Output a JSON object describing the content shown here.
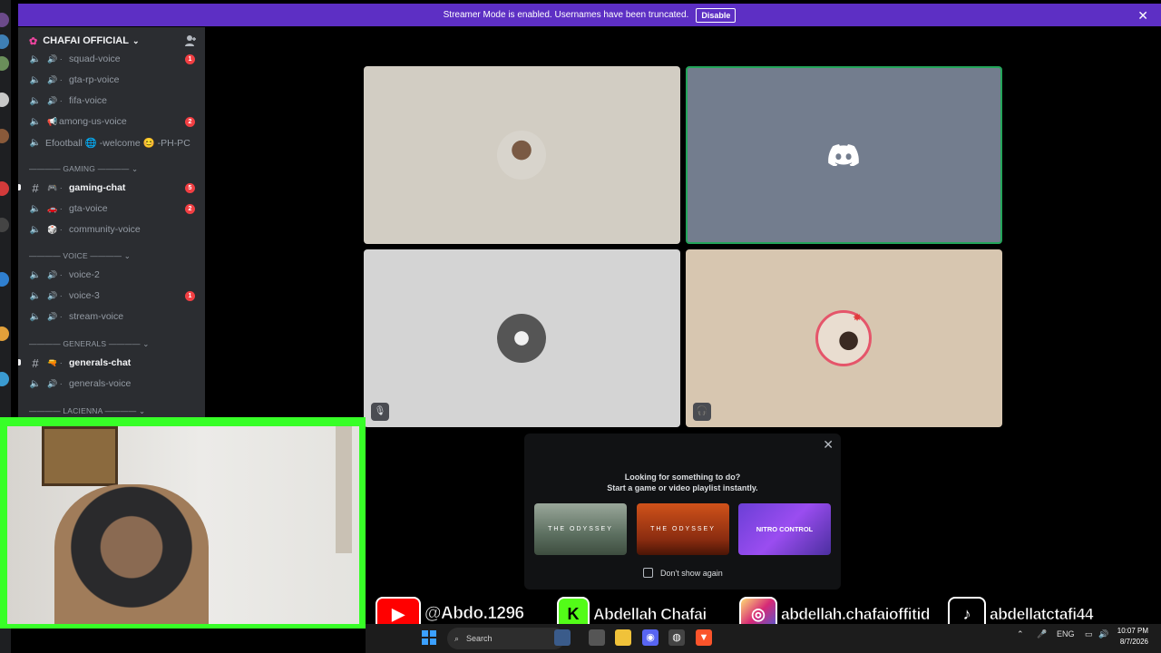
{
  "banner": {
    "message": "Streamer Mode is enabled. Usernames have been truncated.",
    "disable_label": "Disable",
    "close_glyph": "✕"
  },
  "server": {
    "name": "CHAFAI OFFICIAL"
  },
  "channels": [
    {
      "name": "squad-voice",
      "type": "voice",
      "badge": "1"
    },
    {
      "name": "gta-rp-voice",
      "type": "voice"
    },
    {
      "name": "fifa-voice",
      "type": "voice"
    },
    {
      "name": "among-us-voice",
      "type": "voice",
      "badge": "2"
    },
    {
      "name": "Efootball 🌐 -welcome 😊 -PH-PC",
      "type": "voice"
    },
    {
      "name": "GAMING",
      "type": "category"
    },
    {
      "name": "gaming-chat",
      "type": "text",
      "badge": "5"
    },
    {
      "name": "gta-voice",
      "type": "voice",
      "badge": "2"
    },
    {
      "name": "community-voice",
      "type": "voice"
    },
    {
      "name": "VOICE",
      "type": "category"
    },
    {
      "name": "voice-2",
      "type": "voice"
    },
    {
      "name": "voice-3",
      "type": "voice",
      "badge": "1"
    },
    {
      "name": "stream-voice",
      "type": "voice"
    },
    {
      "name": "GENERALS",
      "type": "category"
    },
    {
      "name": "generals-chat",
      "type": "text"
    },
    {
      "name": "generals-voice",
      "type": "voice"
    },
    {
      "name": "LACIENNA",
      "type": "category"
    }
  ],
  "activity_popup": {
    "line1": "Looking for something to do?",
    "line2": "Start a game or video playlist instantly.",
    "games": [
      "THE ODYSSEY",
      "THE ODYSSEY",
      "NITRO CONTROL"
    ],
    "checkbox_label": "Don't show again",
    "close_glyph": "✕"
  },
  "socials": [
    {
      "platform": "youtube-icon",
      "handle": "@Abdo.1296"
    },
    {
      "platform": "kick-icon",
      "handle": "Abdellah Chafai"
    },
    {
      "platform": "instagram-icon",
      "handle": "abdellah.chafaioffitid"
    },
    {
      "platform": "tiktok-icon",
      "handle": "abdellatctafi44"
    }
  ],
  "taskbar": {
    "search_label": "Search",
    "language": "ENG",
    "time": "10:07 PM",
    "date": "8/7/2026"
  },
  "colors": {
    "banner": "#5d2fc4",
    "speaking_border": "#23a55a",
    "badge": "#f23f43",
    "cam_border": "#37ff27"
  }
}
